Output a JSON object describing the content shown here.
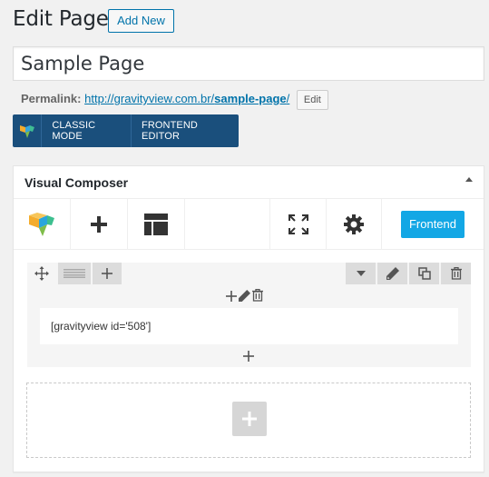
{
  "header": {
    "title": "Edit Page",
    "add_new_label": "Add New"
  },
  "title_input": {
    "value": "Sample Page"
  },
  "permalink": {
    "label": "Permalink:",
    "url_base": "http://gravityview.com.br/",
    "slug": "sample-page",
    "url_trail": "/",
    "edit_label": "Edit"
  },
  "vc_modes": {
    "classic": "CLASSIC MODE",
    "frontend": "FRONTEND EDITOR"
  },
  "panel": {
    "title": "Visual Composer",
    "toolbar": {
      "frontend_label": "Frontend"
    },
    "element_text": "[gravityview id='508']"
  },
  "colors": {
    "wp_blue": "#0073aa",
    "vc_bar": "#1a4f7c",
    "frontend_button": "#13a7e5"
  },
  "icons": [
    "vc-logo-icon",
    "plus-icon",
    "layout-icon",
    "fullscreen-icon",
    "gear-icon",
    "move-icon",
    "column-layout-icon",
    "dropdown-icon",
    "pencil-icon",
    "clone-icon",
    "trash-icon"
  ]
}
